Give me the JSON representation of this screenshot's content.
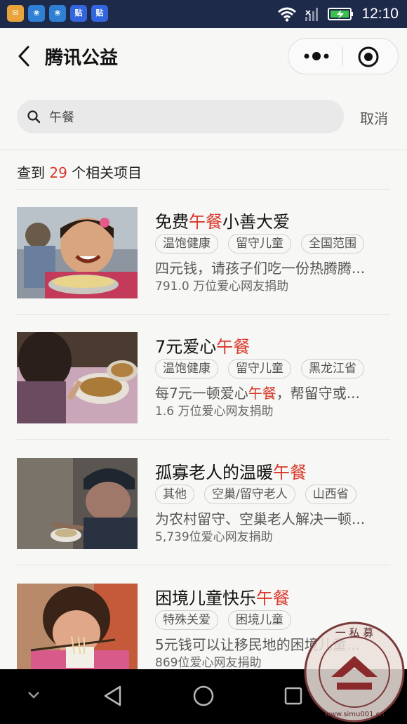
{
  "status_bar": {
    "time": "12:10",
    "notification_apps": [
      {
        "name": "mail-app-icon",
        "label": "",
        "color": "#e8a33a"
      },
      {
        "name": "huawei-app-icon",
        "label": "",
        "color": "#2f7fd4"
      },
      {
        "name": "huawei-app-icon-2",
        "label": "",
        "color": "#2f7fd4"
      },
      {
        "name": "tieba-app-icon",
        "label": "贴",
        "color": "#3366dd"
      },
      {
        "name": "tieba-app-icon-2",
        "label": "贴",
        "color": "#3366dd"
      }
    ]
  },
  "nav": {
    "title": "腾讯公益"
  },
  "search": {
    "query": "午餐",
    "cancel_label": "取消"
  },
  "results": {
    "prefix": "查到",
    "count": "29",
    "suffix": "个相关项目"
  },
  "items": [
    {
      "title_pre": "免费",
      "title_hl": "午餐",
      "title_post": "小善大爱",
      "tags": [
        "温饱健康",
        "留守儿童",
        "全国范围"
      ],
      "desc_pre": "四元钱，请孩子们吃一份热腾腾...",
      "desc_hl": "",
      "desc_post": "",
      "donors": "791.0 万位爱心网友捐助"
    },
    {
      "title_pre": "7元爱心",
      "title_hl": "午餐",
      "title_post": "",
      "tags": [
        "温饱健康",
        "留守儿童",
        "黑龙江省"
      ],
      "desc_pre": "每7元一顿爱心",
      "desc_hl": "午餐",
      "desc_post": "，帮留守或...",
      "donors": "1.6 万位爱心网友捐助"
    },
    {
      "title_pre": "孤寡老人的温暖",
      "title_hl": "午餐",
      "title_post": "",
      "tags": [
        "其他",
        "空巢/留守老人",
        "山西省"
      ],
      "desc_pre": "为农村留守、空巢老人解决一顿...",
      "desc_hl": "",
      "desc_post": "",
      "donors": "5,739位爱心网友捐助"
    },
    {
      "title_pre": "困境儿童快乐",
      "title_hl": "午餐",
      "title_post": "",
      "tags": [
        "特殊关爱",
        "困境儿童"
      ],
      "desc_pre": "5元钱可以让移民地的困境儿童...",
      "desc_hl": "",
      "desc_post": "",
      "donors": "869位爱心网友捐助"
    }
  ],
  "watermark": {
    "text": "一私募 www.simu001.cn"
  },
  "colors": {
    "accent": "#d8372a",
    "status_bar": "#1d2a4a"
  }
}
